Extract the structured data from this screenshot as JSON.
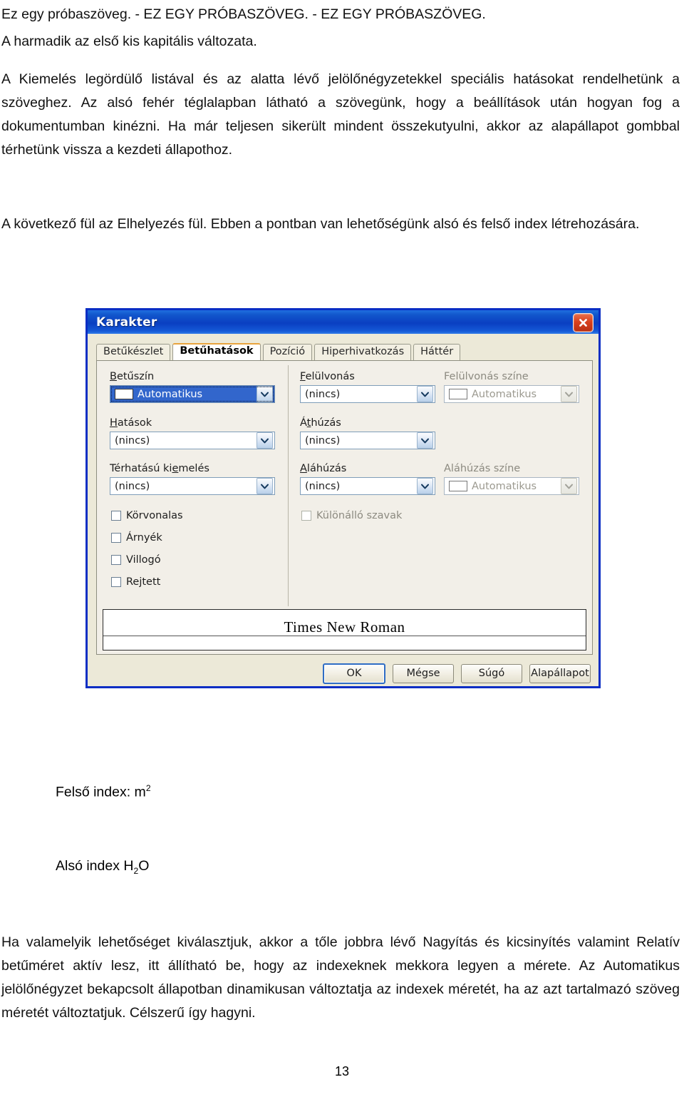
{
  "document": {
    "paragraphs": {
      "intro": "Ez egy próbaszöveg. - EZ EGY PRÓBASZÖVEG. - EZ EGY PRÓBASZÖVEG.",
      "second": "A harmadik az első kis kapitális változata.",
      "third": "A Kiemelés legördülő listával és az alatta lévő jelölőnégyzetekkel speciális hatásokat rendelhetünk a szöveghez. Az alsó fehér téglalapban látható a szövegünk, hogy a beállítások után hogyan fog a dokumentumban kinézni. Ha már teljesen sikerült mindent összekutyulni, akkor az alapállapot gombbal térhetünk vissza a kezdeti állapothoz.",
      "fourth": "A következő fül az Elhelyezés fül. Ebben a pontban van lehetőségünk alsó és felső index létrehozására.",
      "last": "Ha valamelyik lehetőséget kiválasztjuk, akkor a tőle jobbra lévő Nagyítás és kicsinyítés valamint Relatív betűméret aktív lesz, itt állítható be, hogy az indexeknek mekkora legyen a mérete. Az Automatikus jelölőnégyzet bekapcsolt állapotban dinamikusan változtatja az indexek méretét, ha az azt tartalmazó szöveg méretét változtatjuk. Célszerű így hagyni."
    },
    "superscript_example": {
      "prefix": "Felső index: m",
      "exponent": "2"
    },
    "subscript_example": {
      "prefix": "Alsó index H",
      "index": "2",
      "suffix": "O"
    },
    "page_number": "13"
  },
  "dialog": {
    "title": "Karakter",
    "close_icon": "close-icon",
    "tabs": [
      {
        "label": "Betűkészlet",
        "active": false
      },
      {
        "label": "Betűhatások",
        "active": true
      },
      {
        "label": "Pozíció",
        "active": false
      },
      {
        "label": "Hiperhivatkozás",
        "active": false
      },
      {
        "label": "Háttér",
        "active": false
      }
    ],
    "left_column": {
      "font_color_label": "Betűszín",
      "font_color_value": "Automatikus",
      "effects_label": "Hatások",
      "effects_value": "(nincs)",
      "relief_label": "Térhatású kiemelés",
      "relief_value": "(nincs)",
      "checkboxes": [
        {
          "label": "Körvonalas",
          "checked": false,
          "enabled": true
        },
        {
          "label": "Árnyék",
          "checked": false,
          "enabled": true
        },
        {
          "label": "Villogó",
          "checked": false,
          "enabled": true
        },
        {
          "label": "Rejtett",
          "checked": false,
          "enabled": true
        }
      ]
    },
    "middle_column": {
      "overline_label": "Felülvonás",
      "overline_value": "(nincs)",
      "strikethrough_label": "Áthúzás",
      "strikethrough_value": "(nincs)",
      "underline_label": "Aláhúzás",
      "underline_value": "(nincs)",
      "individual_words_label": "Különálló szavak",
      "individual_words_checked": false
    },
    "right_column": {
      "overline_color_label": "Felülvonás színe",
      "overline_color_value": "Automatikus",
      "underline_color_label": "Aláhúzás színe",
      "underline_color_value": "Automatikus"
    },
    "preview": {
      "sample_text": "Times New Roman"
    },
    "buttons": [
      {
        "label": "OK",
        "default": true
      },
      {
        "label": "Mégse",
        "default": false
      },
      {
        "label": "Súgó",
        "default": false
      },
      {
        "label": "Alapállapot",
        "default": false
      }
    ],
    "colors": {
      "titlebar_blue": "#0a3fc2",
      "dialog_face": "#ece9d8",
      "pane_face": "#f2efe8",
      "selection_blue": "#3266cc",
      "close_red": "#d8401d",
      "active_tab_accent": "#e8a33d"
    }
  }
}
